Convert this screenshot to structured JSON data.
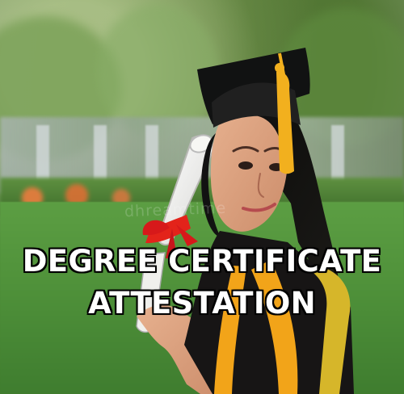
{
  "image": {
    "headline": {
      "line1": "DEGREE CERTIFICATE",
      "line2": "ATTESTATION"
    },
    "watermark": "dhreamtime",
    "colors": {
      "headline_text": "#ffffff",
      "headline_outline": "#000000",
      "tassel": "#f2b01e",
      "ribbon": "#e3231a",
      "gown": "#151414",
      "stole": "#f3a91a"
    },
    "icons": {
      "graduation_cap": "graduation-cap-icon",
      "diploma": "diploma-scroll-icon"
    }
  }
}
